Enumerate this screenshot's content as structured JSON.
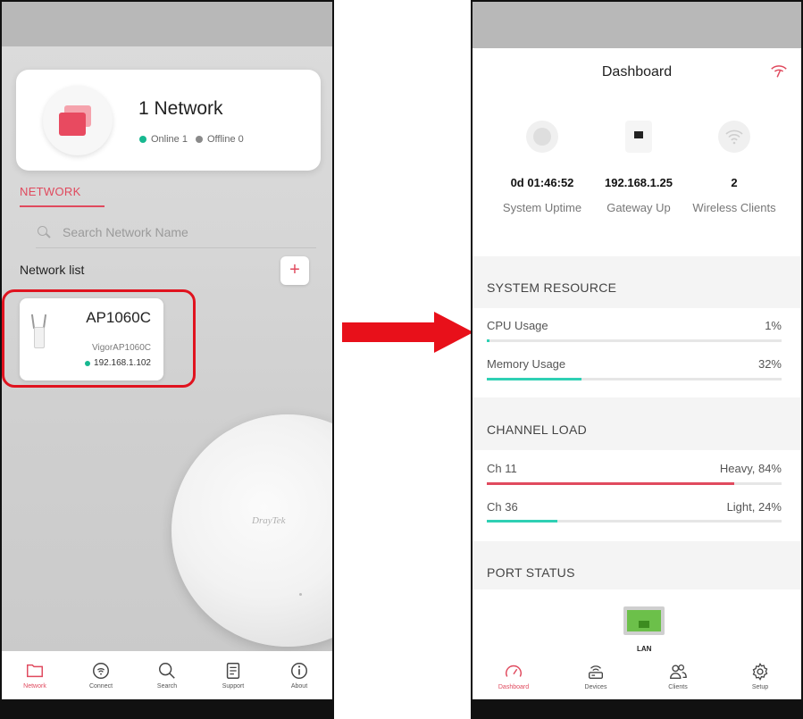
{
  "left": {
    "network_card": {
      "title": "1 Network",
      "online_label": "Online 1",
      "offline_label": "Offline 0"
    },
    "tab_label": "NETWORK",
    "search_placeholder": "Search Network Name",
    "list_label": "Network list",
    "add_label": "+",
    "device": {
      "name": "AP1060C",
      "model": "VigorAP1060C",
      "ip": "192.168.1.102",
      "status_color": "#17b890"
    },
    "product_brand": "DrayTek",
    "nav": [
      {
        "label": "Network",
        "icon": "folder-icon"
      },
      {
        "label": "Connect",
        "icon": "connect-icon"
      },
      {
        "label": "Search",
        "icon": "search-icon"
      },
      {
        "label": "Support",
        "icon": "document-icon"
      },
      {
        "label": "About",
        "icon": "info-icon"
      }
    ]
  },
  "right": {
    "title": "Dashboard",
    "stats": [
      {
        "value": "0d 01:46:52",
        "label": "System Uptime",
        "icon": "globe-icon"
      },
      {
        "value": "192.168.1.25",
        "label": "Gateway Up",
        "icon": "ethernet-icon"
      },
      {
        "value": "2",
        "label": "Wireless Clients",
        "icon": "wifi-icon"
      }
    ],
    "system_resource": {
      "heading": "SYSTEM RESOURCE",
      "cpu": {
        "label": "CPU Usage",
        "value": "1%",
        "fraction": 0.01
      },
      "memory": {
        "label": "Memory Usage",
        "value": "32%",
        "fraction": 0.32
      }
    },
    "channel_load": {
      "heading": "CHANNEL LOAD",
      "ch11": {
        "label": "Ch 11",
        "value": "Heavy, 84%",
        "fraction": 0.84
      },
      "ch36": {
        "label": "Ch 36",
        "value": "Light, 24%",
        "fraction": 0.24
      }
    },
    "port_status": {
      "heading": "PORT STATUS",
      "lan_label": "LAN"
    },
    "nav": [
      {
        "label": "Dashboard",
        "icon": "speedometer-icon"
      },
      {
        "label": "Devices",
        "icon": "router-icon"
      },
      {
        "label": "Clients",
        "icon": "users-icon"
      },
      {
        "label": "Setup",
        "icon": "gear-icon"
      }
    ]
  },
  "colors": {
    "accent": "#e04a5e",
    "teal": "#2fd0b4",
    "heavy": "#e04a5e",
    "highlight": "#e0131f",
    "arrow": "#e8101a"
  }
}
